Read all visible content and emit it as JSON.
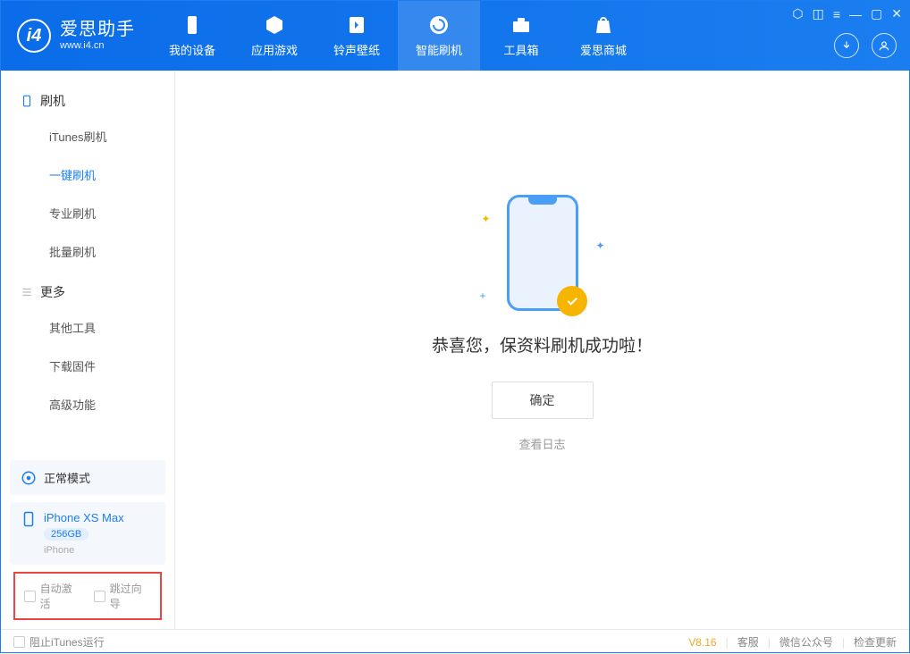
{
  "app": {
    "title": "爱思助手",
    "subtitle": "www.i4.cn"
  },
  "tabs": [
    {
      "label": "我的设备"
    },
    {
      "label": "应用游戏"
    },
    {
      "label": "铃声壁纸"
    },
    {
      "label": "智能刷机"
    },
    {
      "label": "工具箱"
    },
    {
      "label": "爱思商城"
    }
  ],
  "sidebar": {
    "group1": "刷机",
    "items1": [
      {
        "label": "iTunes刷机"
      },
      {
        "label": "一键刷机"
      },
      {
        "label": "专业刷机"
      },
      {
        "label": "批量刷机"
      }
    ],
    "group2": "更多",
    "items2": [
      {
        "label": "其他工具"
      },
      {
        "label": "下载固件"
      },
      {
        "label": "高级功能"
      }
    ],
    "mode": "正常模式",
    "device": {
      "name": "iPhone XS Max",
      "capacity": "256GB",
      "type": "iPhone"
    },
    "options": {
      "auto_activate": "自动激活",
      "skip_guide": "跳过向导"
    }
  },
  "main": {
    "success_msg": "恭喜您，保资料刷机成功啦！",
    "ok_btn": "确定",
    "log_link": "查看日志"
  },
  "footer": {
    "block_itunes": "阻止iTunes运行",
    "version": "V8.16",
    "links": [
      "客服",
      "微信公众号",
      "检查更新"
    ]
  }
}
